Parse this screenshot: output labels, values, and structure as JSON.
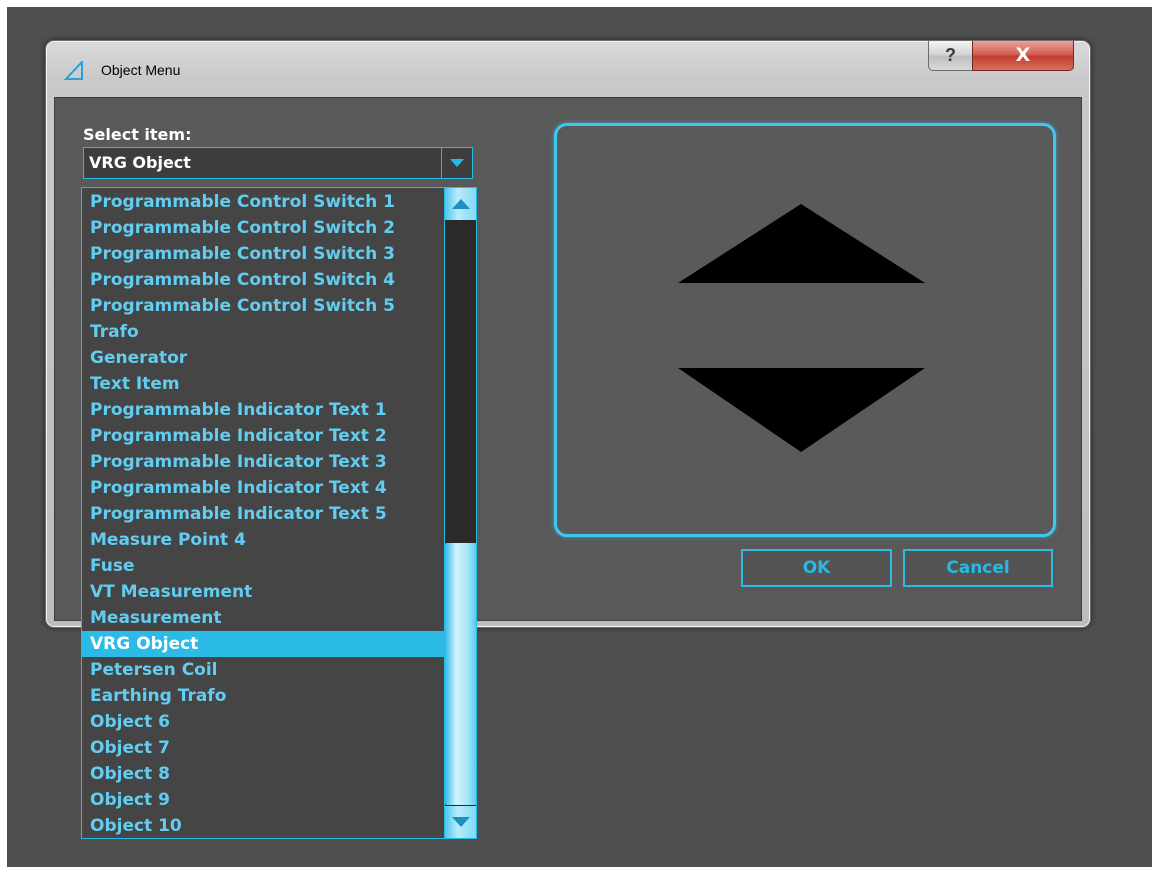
{
  "window": {
    "title": "Object Menu",
    "help_label": "?",
    "close_label": "X"
  },
  "form": {
    "select_label": "Select item:",
    "selected_value": "VRG Object"
  },
  "buttons": {
    "ok_label": "OK",
    "cancel_label": "Cancel"
  },
  "list": {
    "items": [
      "Programmable Control Switch 1",
      "Programmable Control Switch 2",
      "Programmable Control Switch 3",
      "Programmable Control Switch 4",
      "Programmable Control Switch 5",
      "Trafo",
      "Generator",
      "Text Item",
      "Programmable Indicator Text 1",
      "Programmable Indicator Text 2",
      "Programmable Indicator Text 3",
      "Programmable Indicator Text 4",
      "Programmable Indicator Text 5",
      "Measure Point 4",
      "Fuse",
      "VT Measurement",
      "Measurement",
      "VRG Object",
      "Petersen Coil",
      "Earthing Trafo",
      "Object 6",
      "Object 7",
      "Object 8",
      "Object 9",
      "Object 10"
    ],
    "selected_index": 17
  },
  "icons": {
    "app": "app-triangle-icon",
    "help": "help-icon",
    "close": "close-icon",
    "dropdown": "chevron-down-icon",
    "scroll_up": "scroll-up-arrow-icon",
    "scroll_down": "scroll-down-arrow-icon",
    "preview_up": "arrow-up-triangle-icon",
    "preview_down": "arrow-down-triangle-icon"
  },
  "colors": {
    "accent": "#25b9e6",
    "selected_bg": "#2bbbe6",
    "list_text": "#62cdf0",
    "close_button": "#c23a2c",
    "background": "#4f4f4f"
  }
}
